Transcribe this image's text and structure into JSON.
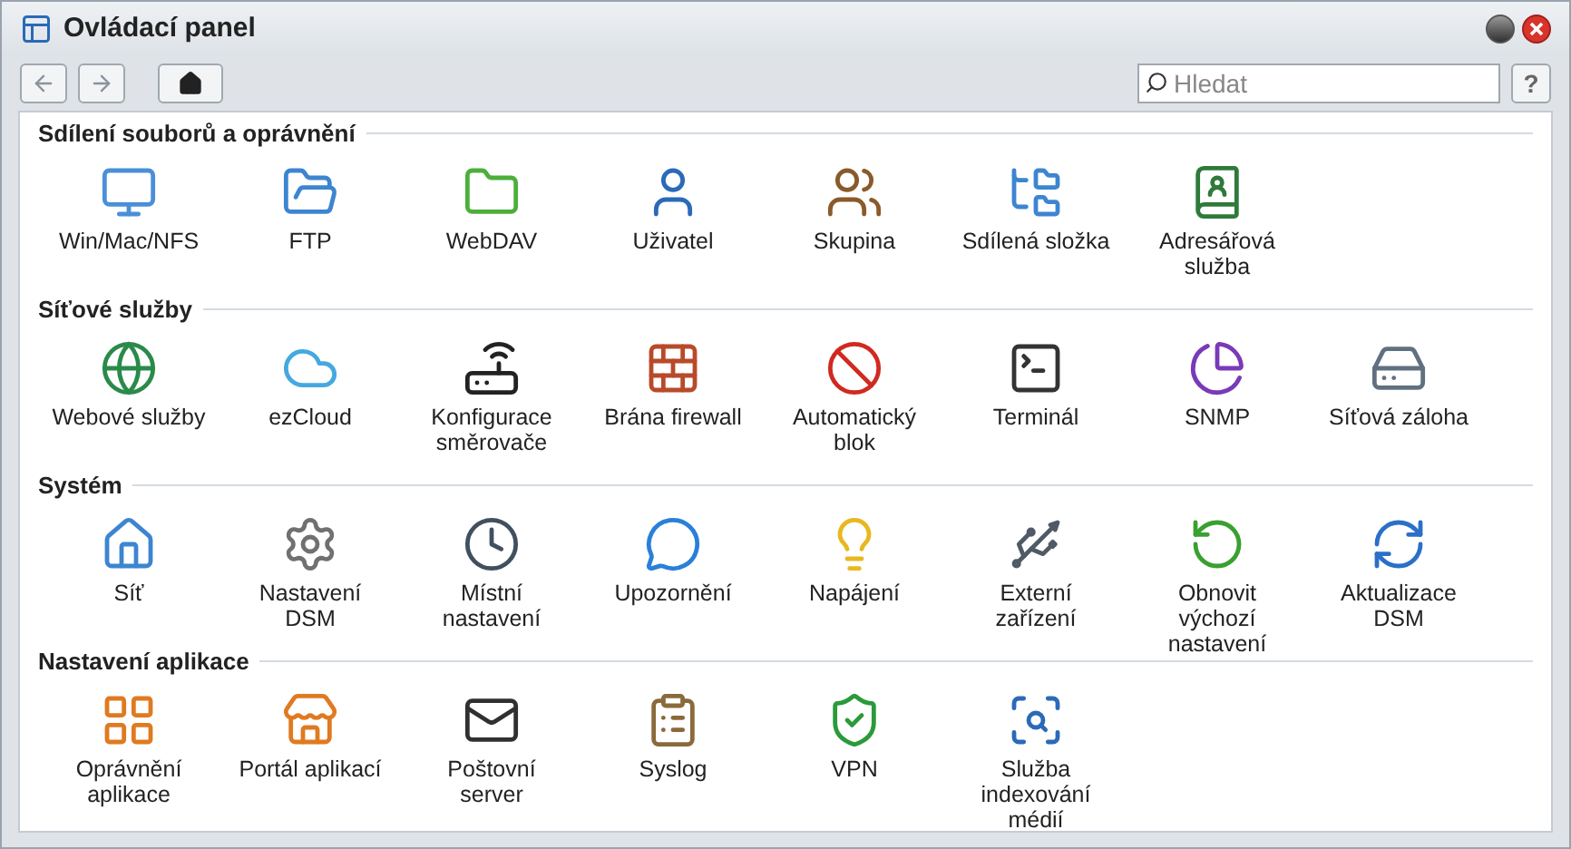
{
  "window": {
    "title": "Ovládací panel"
  },
  "search": {
    "placeholder": "Hledat"
  },
  "help": "?",
  "sections": [
    {
      "title": "Sdílení souborů a oprávnění",
      "items": [
        "Win/Mac/NFS",
        "FTP",
        "WebDAV",
        "Uživatel",
        "Skupina",
        "Sdílená složka",
        "Adresářová služba"
      ]
    },
    {
      "title": "Síťové služby",
      "items": [
        "Webové služby",
        "ezCloud",
        "Konfigurace směrovače",
        "Brána firewall",
        "Automatický blok",
        "Terminál",
        "SNMP",
        "Síťová záloha"
      ]
    },
    {
      "title": "Systém",
      "items": [
        "Síť",
        "Nastavení DSM",
        "Místní nastavení",
        "Upozornění",
        "Napájení",
        "Externí zařízení",
        "Obnovit výchozí nastavení",
        "Aktualizace DSM"
      ]
    },
    {
      "title": "Nastavení aplikace",
      "items": [
        "Oprávnění aplikace",
        "Portál aplikací",
        "Poštovní server",
        "Syslog",
        "VPN",
        "Služba indexování médií"
      ]
    }
  ]
}
